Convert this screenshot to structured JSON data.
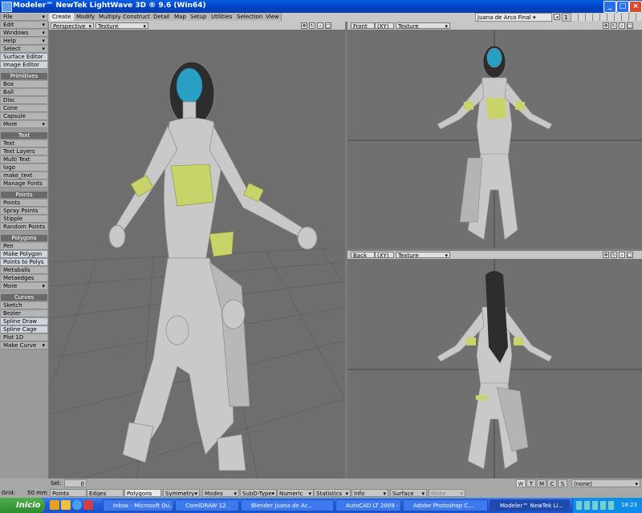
{
  "window": {
    "title": "Modeler™ NewTek LightWave 3D ® 9.6  (Win64)"
  },
  "tabs": [
    "Create",
    "Modify",
    "Multiply",
    "Construct",
    "Detail",
    "Map",
    "Setup",
    "Utilities",
    "Selection",
    "View"
  ],
  "object_select": "Juana de Arco Final",
  "layer_num": "1",
  "sidebar": {
    "menus": [
      {
        "label": "File",
        "type": "menu"
      },
      {
        "label": "Edit",
        "type": "menu"
      },
      {
        "label": "Windows",
        "type": "menu"
      },
      {
        "label": "Help",
        "type": "menu"
      },
      {
        "label": "Select",
        "type": "menu"
      },
      {
        "label": "Surface Editor",
        "type": "sel"
      },
      {
        "label": "Image Editor",
        "type": "sel"
      },
      {
        "label": "Primitives",
        "type": "hdr"
      },
      {
        "label": "Box",
        "type": "btn"
      },
      {
        "label": "Ball",
        "type": "btn"
      },
      {
        "label": "Disc",
        "type": "btn"
      },
      {
        "label": "Cone",
        "type": "btn"
      },
      {
        "label": "Capsule",
        "type": "btn"
      },
      {
        "label": "More",
        "type": "menu"
      },
      {
        "label": "Text",
        "type": "hdr"
      },
      {
        "label": "Text",
        "type": "btn"
      },
      {
        "label": "Text Layers",
        "type": "btn"
      },
      {
        "label": "Multi Text",
        "type": "btn"
      },
      {
        "label": "logo",
        "type": "btn"
      },
      {
        "label": "make_text",
        "type": "btn"
      },
      {
        "label": "Manage Fonts",
        "type": "btn"
      },
      {
        "label": "Points",
        "type": "hdr"
      },
      {
        "label": "Points",
        "type": "btn"
      },
      {
        "label": "Spray Points",
        "type": "btn"
      },
      {
        "label": "Stipple",
        "type": "btn"
      },
      {
        "label": "Random Points",
        "type": "btn"
      },
      {
        "label": "Polygons",
        "type": "hdr"
      },
      {
        "label": "Pen",
        "type": "btn"
      },
      {
        "label": "Make Polygon",
        "type": "sel"
      },
      {
        "label": "Points to Polys",
        "type": "sel"
      },
      {
        "label": "Metaballs",
        "type": "btn"
      },
      {
        "label": "Metaedges",
        "type": "btn"
      },
      {
        "label": "More",
        "type": "menu"
      },
      {
        "label": "Curves",
        "type": "hdr"
      },
      {
        "label": "Sketch",
        "type": "btn"
      },
      {
        "label": "Bezier",
        "type": "btn"
      },
      {
        "label": "Spline Draw",
        "type": "sel"
      },
      {
        "label": "Spline Cage",
        "type": "sel"
      },
      {
        "label": "Plot 1D",
        "type": "btn"
      },
      {
        "label": "Make Curve",
        "type": "menu"
      }
    ]
  },
  "viewports": {
    "perspective": {
      "view": "Perspective",
      "mode": "Texture"
    },
    "front": {
      "view": "Front",
      "axis": "(XY)",
      "mode": "Texture"
    },
    "back": {
      "view": "Back",
      "axis": "(XY)",
      "mode": "Texture"
    }
  },
  "status": {
    "sel_label": "Sel:",
    "sel_value": "0",
    "grid_label": "Grid:",
    "grid_value": "50 mm",
    "modes": [
      "Points",
      "Edges",
      "Polygons"
    ],
    "dropdowns": [
      "Symmetry",
      "Modes",
      "SubD-Type",
      "Numeric",
      "Statistics",
      "Info",
      "Surface",
      "Make"
    ],
    "wtmcs": [
      "W",
      "T",
      "M",
      "C",
      "S"
    ],
    "vmap": "(none)"
  },
  "taskbar": {
    "start": "Inicio",
    "items": [
      "Inbox - Microsoft Ou...",
      "CorelDRAW 12",
      "Blender Juana de Ar...",
      "AutoCAD LT 2009 - [...",
      "Adobe Photoshop C...",
      "Modeler™ NewTek Li..."
    ],
    "clock": "18:23"
  }
}
